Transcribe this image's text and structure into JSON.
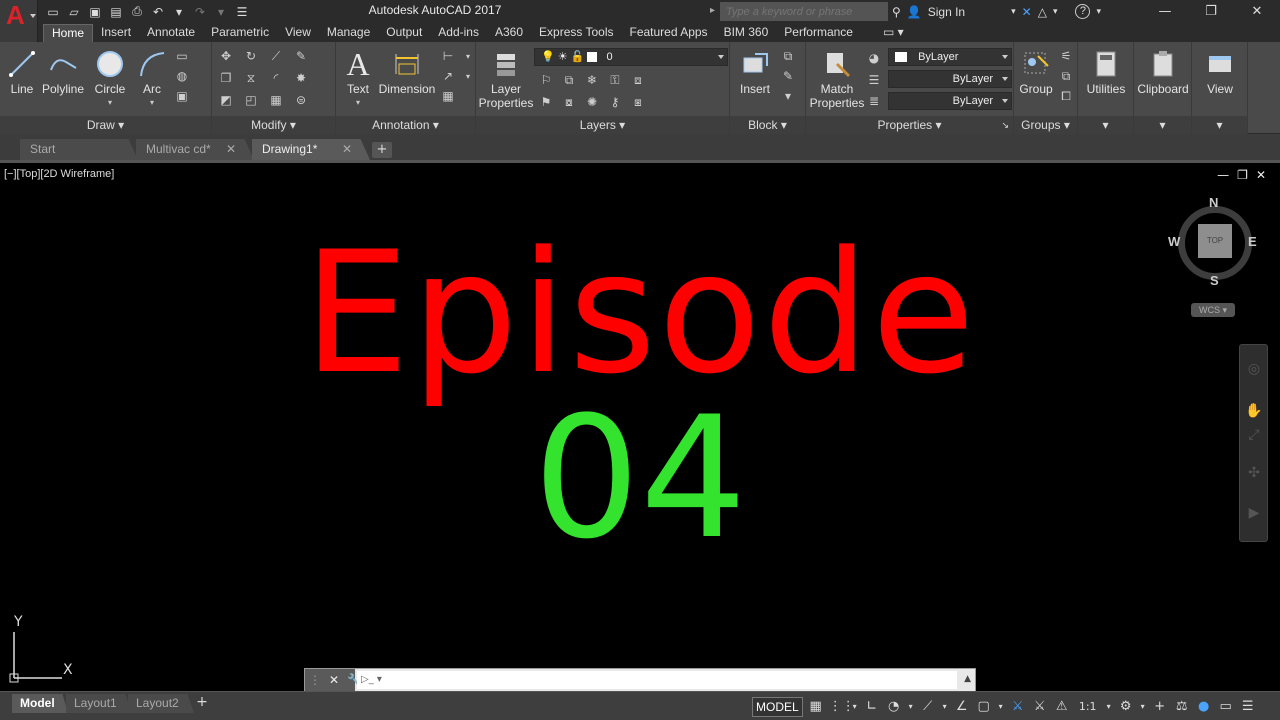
{
  "app": {
    "title": "Autodesk AutoCAD 2017",
    "logo_letter": "A",
    "search_placeholder": "Type a keyword or phrase",
    "sign_in": "Sign In",
    "help": "?"
  },
  "ribbon_tabs": [
    "Home",
    "Insert",
    "Annotate",
    "Parametric",
    "View",
    "Manage",
    "Output",
    "Add-ins",
    "A360",
    "Express Tools",
    "Featured Apps",
    "BIM 360",
    "Performance"
  ],
  "ribbon": {
    "draw": {
      "label": "Draw",
      "line": "Line",
      "polyline": "Polyline",
      "circle": "Circle",
      "arc": "Arc"
    },
    "modify": {
      "label": "Modify"
    },
    "annotation": {
      "label": "Annotation",
      "text": "Text",
      "dimension": "Dimension"
    },
    "layers": {
      "label": "Layers",
      "layer_properties": "Layer\nProperties",
      "current_layer": "0"
    },
    "block": {
      "label": "Block",
      "insert": "Insert"
    },
    "properties": {
      "label": "Properties",
      "match": "Match\nProperties",
      "color": "ByLayer",
      "linetype": "ByLayer",
      "lineweight": "ByLayer"
    },
    "groups": {
      "label": "Groups",
      "group": "Group"
    },
    "utilities": "Utilities",
    "clipboard": "Clipboard",
    "view": "View"
  },
  "doc_tabs": [
    {
      "label": "Start"
    },
    {
      "label": "Multivac cd*"
    },
    {
      "label": "Drawing1*"
    }
  ],
  "viewport": {
    "label": "[−][Top][2D Wireframe]",
    "title_text": "Episode",
    "number_text": "04",
    "title_color": "#ff0000",
    "number_color": "#33e32e"
  },
  "viewcube": {
    "n": "N",
    "s": "S",
    "e": "E",
    "w": "W",
    "top": "TOP",
    "wcs": "WCS"
  },
  "ucs": {
    "x": "X",
    "y": "Y"
  },
  "layout_tabs": [
    "Model",
    "Layout1",
    "Layout2"
  ],
  "status": {
    "model": "MODEL",
    "scale": "1:1"
  }
}
